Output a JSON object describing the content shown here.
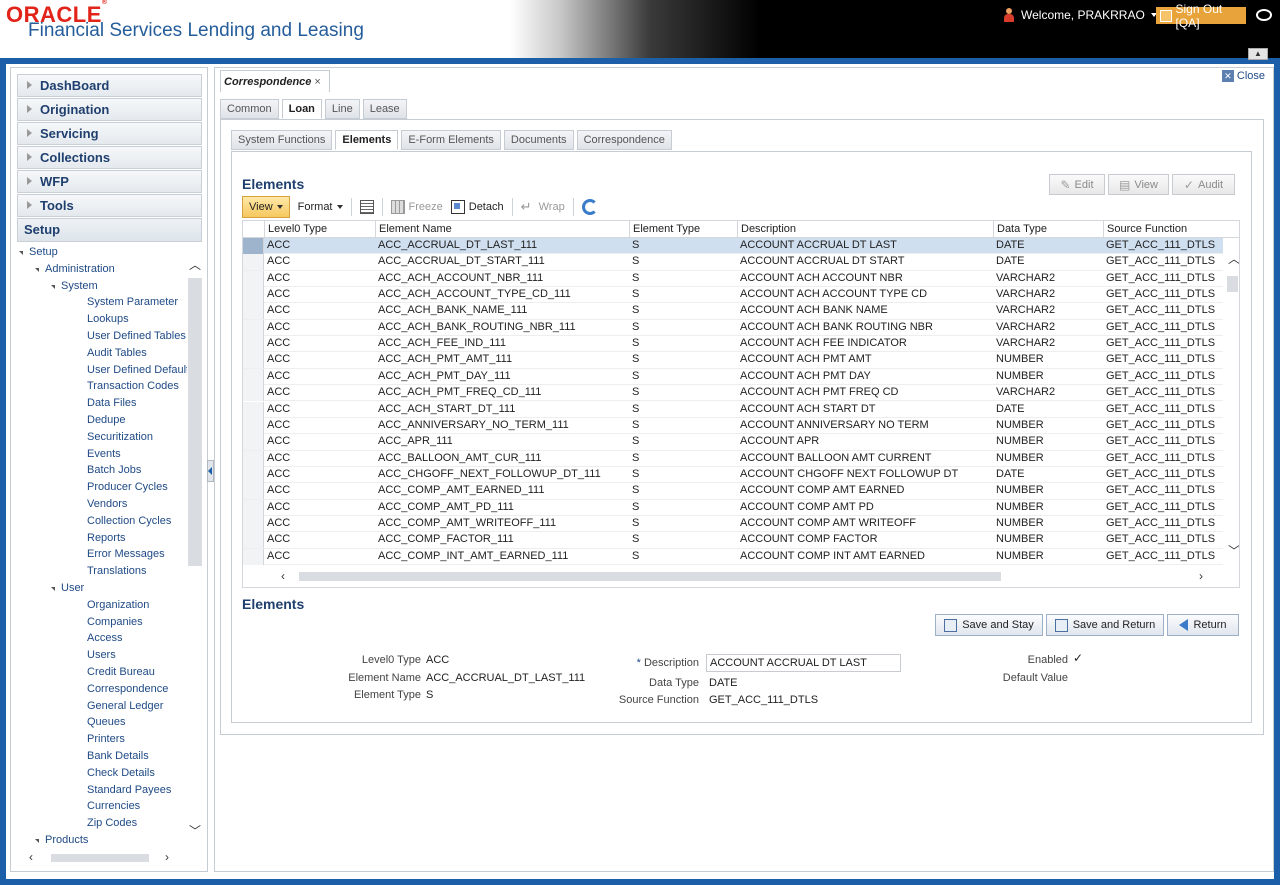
{
  "header": {
    "brand": "ORACLE",
    "app_title": "Financial Services Lending and Leasing",
    "welcome": "Welcome, PRAKRRAO",
    "signout": "Sign Out [QA]"
  },
  "sidebar": {
    "nav": [
      "DashBoard",
      "Origination",
      "Servicing",
      "Collections",
      "WFP",
      "Tools"
    ],
    "setup_label": "Setup",
    "tree": [
      {
        "label": "Setup",
        "level": 0,
        "expanded": true
      },
      {
        "label": "Administration",
        "level": 1,
        "expanded": true
      },
      {
        "label": "System",
        "level": 2,
        "expanded": true
      },
      {
        "label": "System Parameter",
        "level": 3
      },
      {
        "label": "Lookups",
        "level": 3
      },
      {
        "label": "User Defined Tables",
        "level": 3
      },
      {
        "label": "Audit Tables",
        "level": 3
      },
      {
        "label": "User Defined Default",
        "level": 3
      },
      {
        "label": "Transaction Codes",
        "level": 3
      },
      {
        "label": "Data Files",
        "level": 3
      },
      {
        "label": "Dedupe",
        "level": 3
      },
      {
        "label": "Securitization",
        "level": 3
      },
      {
        "label": "Events",
        "level": 3
      },
      {
        "label": "Batch Jobs",
        "level": 3
      },
      {
        "label": "Producer Cycles",
        "level": 3
      },
      {
        "label": "Vendors",
        "level": 3
      },
      {
        "label": "Collection Cycles",
        "level": 3
      },
      {
        "label": "Reports",
        "level": 3
      },
      {
        "label": "Error Messages",
        "level": 3
      },
      {
        "label": "Translations",
        "level": 3
      },
      {
        "label": "User",
        "level": 2,
        "expanded": true
      },
      {
        "label": "Organization",
        "level": 3
      },
      {
        "label": "Companies",
        "level": 3
      },
      {
        "label": "Access",
        "level": 3
      },
      {
        "label": "Users",
        "level": 3
      },
      {
        "label": "Credit Bureau",
        "level": 3
      },
      {
        "label": "Correspondence",
        "level": 3
      },
      {
        "label": "General Ledger",
        "level": 3
      },
      {
        "label": "Queues",
        "level": 3
      },
      {
        "label": "Printers",
        "level": 3
      },
      {
        "label": "Bank Details",
        "level": 3
      },
      {
        "label": "Check Details",
        "level": 3
      },
      {
        "label": "Standard Payees",
        "level": 3
      },
      {
        "label": "Currencies",
        "level": 3
      },
      {
        "label": "Zip Codes",
        "level": 3
      },
      {
        "label": "Products",
        "level": 1,
        "expanded": true
      }
    ]
  },
  "main": {
    "doc_tab": "Correspondence",
    "close_label": "Close",
    "tabs1": [
      "Common",
      "Loan",
      "Line",
      "Lease"
    ],
    "tabs1_active": 1,
    "tabs2": [
      "System Functions",
      "Elements",
      "E-Form Elements",
      "Documents",
      "Correspondence"
    ],
    "tabs2_active": 1,
    "grid_title": "Elements",
    "actions": {
      "edit": "Edit",
      "view": "View",
      "audit": "Audit"
    },
    "toolbar": {
      "view": "View",
      "format": "Format",
      "freeze": "Freeze",
      "detach": "Detach",
      "wrap": "Wrap"
    },
    "columns": [
      "Level0 Type",
      "Element Name",
      "Element Type",
      "Description",
      "Data Type",
      "Source Function"
    ],
    "rows": [
      [
        "ACC",
        "ACC_ACCRUAL_DT_LAST_111",
        "S",
        "ACCOUNT ACCRUAL DT LAST",
        "DATE",
        "GET_ACC_111_DTLS"
      ],
      [
        "ACC",
        "ACC_ACCRUAL_DT_START_111",
        "S",
        "ACCOUNT ACCRUAL DT START",
        "DATE",
        "GET_ACC_111_DTLS"
      ],
      [
        "ACC",
        "ACC_ACH_ACCOUNT_NBR_111",
        "S",
        "ACCOUNT ACH ACCOUNT NBR",
        "VARCHAR2",
        "GET_ACC_111_DTLS"
      ],
      [
        "ACC",
        "ACC_ACH_ACCOUNT_TYPE_CD_111",
        "S",
        "ACCOUNT ACH ACCOUNT TYPE CD",
        "VARCHAR2",
        "GET_ACC_111_DTLS"
      ],
      [
        "ACC",
        "ACC_ACH_BANK_NAME_111",
        "S",
        "ACCOUNT ACH BANK NAME",
        "VARCHAR2",
        "GET_ACC_111_DTLS"
      ],
      [
        "ACC",
        "ACC_ACH_BANK_ROUTING_NBR_111",
        "S",
        "ACCOUNT ACH BANK ROUTING NBR",
        "VARCHAR2",
        "GET_ACC_111_DTLS"
      ],
      [
        "ACC",
        "ACC_ACH_FEE_IND_111",
        "S",
        "ACCOUNT ACH FEE INDICATOR",
        "VARCHAR2",
        "GET_ACC_111_DTLS"
      ],
      [
        "ACC",
        "ACC_ACH_PMT_AMT_111",
        "S",
        "ACCOUNT ACH PMT AMT",
        "NUMBER",
        "GET_ACC_111_DTLS"
      ],
      [
        "ACC",
        "ACC_ACH_PMT_DAY_111",
        "S",
        "ACCOUNT ACH PMT DAY",
        "NUMBER",
        "GET_ACC_111_DTLS"
      ],
      [
        "ACC",
        "ACC_ACH_PMT_FREQ_CD_111",
        "S",
        "ACCOUNT ACH PMT FREQ CD",
        "VARCHAR2",
        "GET_ACC_111_DTLS"
      ],
      [
        "ACC",
        "ACC_ACH_START_DT_111",
        "S",
        "ACCOUNT ACH START DT",
        "DATE",
        "GET_ACC_111_DTLS"
      ],
      [
        "ACC",
        "ACC_ANNIVERSARY_NO_TERM_111",
        "S",
        "ACCOUNT ANNIVERSARY NO TERM",
        "NUMBER",
        "GET_ACC_111_DTLS"
      ],
      [
        "ACC",
        "ACC_APR_111",
        "S",
        "ACCOUNT APR",
        "NUMBER",
        "GET_ACC_111_DTLS"
      ],
      [
        "ACC",
        "ACC_BALLOON_AMT_CUR_111",
        "S",
        "ACCOUNT BALLOON AMT CURRENT",
        "NUMBER",
        "GET_ACC_111_DTLS"
      ],
      [
        "ACC",
        "ACC_CHGOFF_NEXT_FOLLOWUP_DT_111",
        "S",
        "ACCOUNT CHGOFF NEXT FOLLOWUP DT",
        "DATE",
        "GET_ACC_111_DTLS"
      ],
      [
        "ACC",
        "ACC_COMP_AMT_EARNED_111",
        "S",
        "ACCOUNT COMP AMT EARNED",
        "NUMBER",
        "GET_ACC_111_DTLS"
      ],
      [
        "ACC",
        "ACC_COMP_AMT_PD_111",
        "S",
        "ACCOUNT COMP AMT PD",
        "NUMBER",
        "GET_ACC_111_DTLS"
      ],
      [
        "ACC",
        "ACC_COMP_AMT_WRITEOFF_111",
        "S",
        "ACCOUNT COMP AMT WRITEOFF",
        "NUMBER",
        "GET_ACC_111_DTLS"
      ],
      [
        "ACC",
        "ACC_COMP_FACTOR_111",
        "S",
        "ACCOUNT COMP FACTOR",
        "NUMBER",
        "GET_ACC_111_DTLS"
      ],
      [
        "ACC",
        "ACC_COMP_INT_AMT_EARNED_111",
        "S",
        "ACCOUNT COMP INT AMT EARNED",
        "NUMBER",
        "GET_ACC_111_DTLS"
      ]
    ],
    "selected_row": 0,
    "form": {
      "title": "Elements",
      "buttons": {
        "save_stay": "Save and Stay",
        "save_return": "Save and Return",
        "return": "Return"
      },
      "level0_label": "Level0 Type",
      "level0_value": "ACC",
      "element_name_label": "Element Name",
      "element_name_value": "ACC_ACCRUAL_DT_LAST_111",
      "element_type_label": "Element Type",
      "element_type_value": "S",
      "description_label": "Description",
      "description_value": "ACCOUNT ACCRUAL DT LAST",
      "data_type_label": "Data Type",
      "data_type_value": "DATE",
      "source_function_label": "Source Function",
      "source_function_value": "GET_ACC_111_DTLS",
      "enabled_label": "Enabled",
      "enabled_checked": true,
      "default_value_label": "Default Value"
    }
  }
}
